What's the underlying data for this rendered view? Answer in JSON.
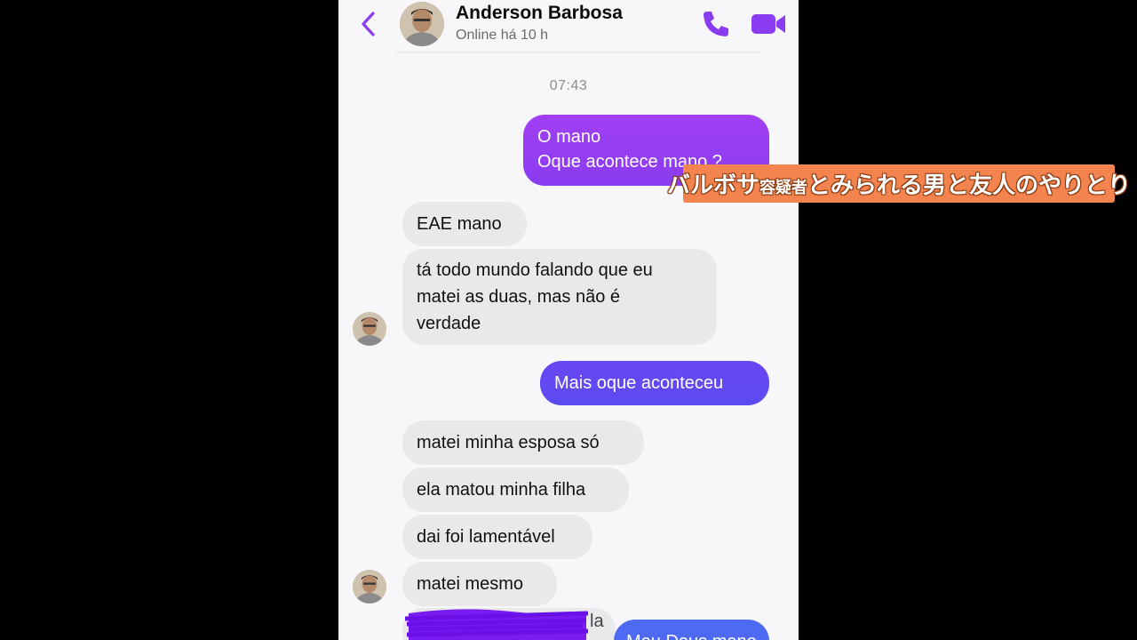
{
  "header": {
    "contact_name": "Anderson Barbosa",
    "status": "Online há 10 h",
    "icons": [
      "back-chevron-icon",
      "avatar",
      "phone-icon",
      "video-camera-icon"
    ]
  },
  "timestamp": "07:43",
  "messages": {
    "out1_line1": "O mano",
    "out1_line2": "Oque acontece mano ?",
    "in1": "EAE mano",
    "in2_line1": "tá todo mundo falando que eu",
    "in2_line2": "matei as duas, mas não é",
    "in2_line3": "verdade",
    "out2": "Mais oque aconteceu",
    "in3": "matei minha esposa só",
    "in4": "ela matou minha filha",
    "in5": "dai foi lamentável",
    "in6": "matei mesmo",
    "in7_partial": "la",
    "out3_partial": "Meu Deus mano"
  },
  "caption": {
    "part1": "バルボサ",
    "part2": "容疑者",
    "part3": "とみられる男と友人のやりとり"
  },
  "colors": {
    "accent": "#8a3cf0",
    "bubble_in": "#e9e9eb",
    "banner": "#f4844f",
    "scribble": "#7a1cf0"
  }
}
